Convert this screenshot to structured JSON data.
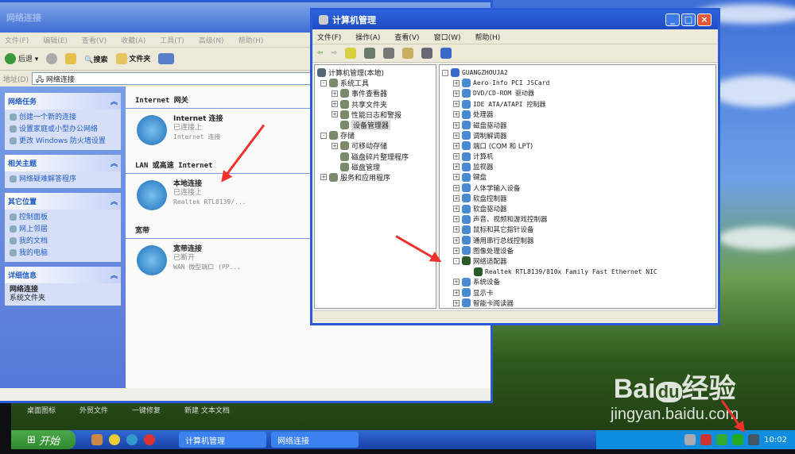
{
  "network_window": {
    "title": "网络连接",
    "menu": [
      "文件(F)",
      "编辑(E)",
      "查看(V)",
      "收藏(A)",
      "工具(T)",
      "高级(N)",
      "帮助(H)"
    ],
    "toolbar": {
      "back": "后退",
      "search": "搜索",
      "folders": "文件夹"
    },
    "address": {
      "label": "地址(D)",
      "value": "网络连接"
    },
    "panels": [
      {
        "title": "网络任务",
        "items": [
          "创建一个新的连接",
          "设置家庭或小型办公网络",
          "更改 Windows 防火墙设置"
        ]
      },
      {
        "title": "相关主题",
        "items": [
          "网络疑难解答程序"
        ]
      },
      {
        "title": "其它位置",
        "items": [
          "控制面板",
          "网上邻居",
          "我的文档",
          "我的电脑"
        ]
      },
      {
        "title": "详细信息",
        "items": [
          "网络连接",
          "系统文件夹"
        ]
      }
    ],
    "sections": [
      {
        "header": "Internet 网关",
        "connections": [
          {
            "name": "Internet 连接",
            "status": "已连接上",
            "device": "Internet 连接"
          }
        ]
      },
      {
        "header": "LAN 或高速 Internet",
        "connections": [
          {
            "name": "本地连接",
            "status": "已连接上",
            "device": "Realtek RTL8139/..."
          }
        ]
      },
      {
        "header": "宽带",
        "connections": [
          {
            "name": "宽带连接",
            "status": "已断开",
            "device": "WAN 微型端口 (PP..."
          }
        ]
      }
    ]
  },
  "mgmt_window": {
    "title": "计算机管理",
    "menu": [
      "文件(F)",
      "操作(A)",
      "查看(V)",
      "窗口(W)",
      "帮助(H)"
    ],
    "tree": {
      "root": "计算机管理(本地)",
      "items": [
        {
          "label": "系统工具",
          "level": 1,
          "toggle": "-"
        },
        {
          "label": "事件查看器",
          "level": 2,
          "toggle": "+"
        },
        {
          "label": "共享文件夹",
          "level": 2,
          "toggle": "+"
        },
        {
          "label": "性能日志和警报",
          "level": 2,
          "toggle": "+"
        },
        {
          "label": "设备管理器",
          "level": 2,
          "toggle": "",
          "selected": true
        },
        {
          "label": "存储",
          "level": 1,
          "toggle": "-"
        },
        {
          "label": "可移动存储",
          "level": 2,
          "toggle": "+"
        },
        {
          "label": "磁盘碎片整理程序",
          "level": 2,
          "toggle": ""
        },
        {
          "label": "磁盘管理",
          "level": 2,
          "toggle": ""
        },
        {
          "label": "服务和应用程序",
          "level": 1,
          "toggle": "+"
        }
      ]
    },
    "devices": {
      "computer": "GUANGZHOUJA2",
      "items": [
        {
          "label": "Aero-Info PCI JSCard",
          "toggle": "+"
        },
        {
          "label": "DVD/CD-ROM 驱动器",
          "toggle": "+"
        },
        {
          "label": "IDE ATA/ATAPI 控制器",
          "toggle": "+"
        },
        {
          "label": "处理器",
          "toggle": "+"
        },
        {
          "label": "磁盘驱动器",
          "toggle": "+"
        },
        {
          "label": "调制解调器",
          "toggle": "+"
        },
        {
          "label": "端口 (COM 和 LPT)",
          "toggle": "+"
        },
        {
          "label": "计算机",
          "toggle": "+"
        },
        {
          "label": "监视器",
          "toggle": "+"
        },
        {
          "label": "键盘",
          "toggle": "+"
        },
        {
          "label": "人体学输入设备",
          "toggle": "+"
        },
        {
          "label": "软盘控制器",
          "toggle": "+"
        },
        {
          "label": "软盘驱动器",
          "toggle": "+"
        },
        {
          "label": "声音、视频和游戏控制器",
          "toggle": "+"
        },
        {
          "label": "鼠标和其它指针设备",
          "toggle": "+"
        },
        {
          "label": "通用串行总线控制器",
          "toggle": "+"
        },
        {
          "label": "图像处理设备",
          "toggle": "+"
        },
        {
          "label": "网络适配器",
          "toggle": "-"
        },
        {
          "label": "Realtek RTL8139/810x Family Fast Ethernet NIC",
          "toggle": "",
          "child": true
        },
        {
          "label": "系统设备",
          "toggle": "+"
        },
        {
          "label": "显示卡",
          "toggle": "+"
        },
        {
          "label": "智能卡阅读器",
          "toggle": "+"
        }
      ]
    }
  },
  "desktop_icons": [
    "桌面图标",
    "外贸文件",
    "一键修复",
    "新建 文本文档"
  ],
  "taskbar": {
    "start": "开始",
    "tasks": [
      "计算机管理",
      "网络连接"
    ],
    "clock": "10:02"
  },
  "watermark": {
    "logo": "Bai du 经验",
    "url": "jingyan.baidu.com"
  },
  "colors": {
    "xp_blue": "#2a5bd6",
    "arrow": "#f0322d"
  }
}
